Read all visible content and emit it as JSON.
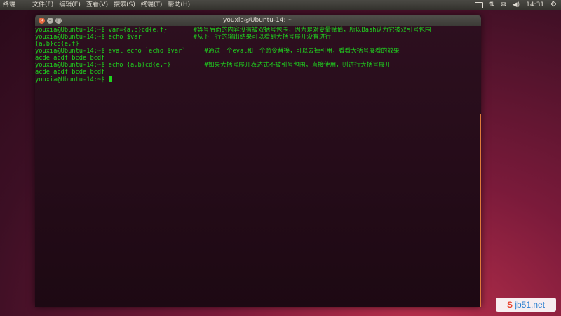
{
  "panel": {
    "app_title": "终端",
    "menu": [
      "文件(F)",
      "编辑(E)",
      "查看(V)",
      "搜索(S)",
      "终端(T)",
      "帮助(H)"
    ],
    "clock": "14:31"
  },
  "window": {
    "title": "youxia@Ubuntu-14: ~"
  },
  "terminal": {
    "lines": [
      {
        "cmd": "youxia@Ubuntu-14:~$ var={a,b}cd{e,f}",
        "comment": "#等号后面的内容没有被双括号包围，因为是对变量赋值，所以Bash认为它被双引号包围",
        "comment_col": 43
      },
      {
        "cmd": "youxia@Ubuntu-14:~$ echo $var",
        "comment": "#从下一行的输出结果可以看到大括号展开没有进行",
        "comment_col": 43
      },
      {
        "cmd": "{a,b}cd{e,f}",
        "comment": "",
        "comment_col": 0
      },
      {
        "cmd": "youxia@Ubuntu-14:~$ eval echo `echo $var`",
        "comment": "#通过一个eval和一个命令替换，可以去掉引用，看看大括号展看的效果",
        "comment_col": 46
      },
      {
        "cmd": "acde acdf bcde bcdf",
        "comment": "",
        "comment_col": 0
      },
      {
        "cmd": "youxia@Ubuntu-14:~$ echo {a,b}cd{e,f}",
        "comment": "#如果大括号展开表达式不被引号包围，直接使用，则进行大括号展开",
        "comment_col": 46
      },
      {
        "cmd": "acde acdf bcde bcdf",
        "comment": "",
        "comment_col": 0
      }
    ],
    "prompt": "youxia@Ubuntu-14:~$ "
  },
  "watermark": {
    "brand_mark": "S",
    "site": "jb51.net"
  },
  "colors": {
    "terminal_text": "#1fd31f",
    "accent": "#e9683e"
  }
}
